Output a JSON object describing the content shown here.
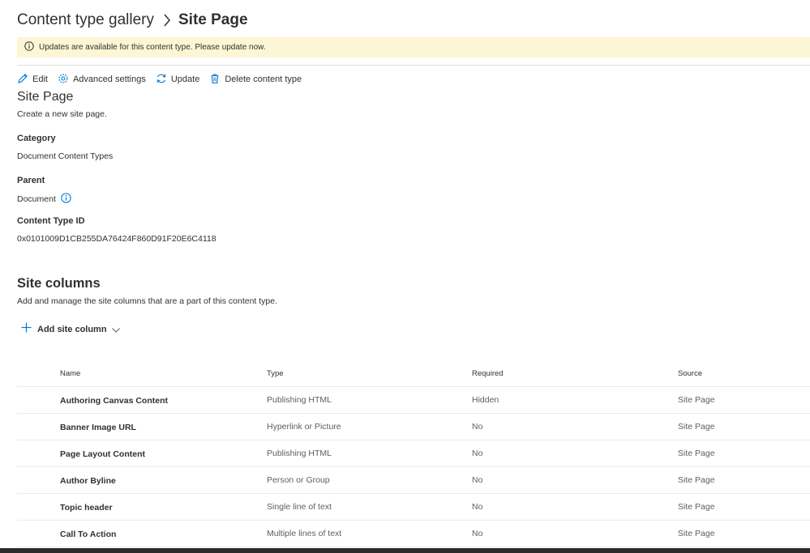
{
  "breadcrumb": {
    "root": "Content type gallery",
    "separator_icon": "chevron-right-icon",
    "current": "Site Page"
  },
  "banner": {
    "icon": "info-icon",
    "text": "Updates are available for this content type. Please update now.",
    "background": "#fdf6d5"
  },
  "commands": {
    "edit": "Edit",
    "advanced": "Advanced settings",
    "update": "Update",
    "delete": "Delete content type"
  },
  "details": {
    "title": "Site Page",
    "description": "Create a new site page.",
    "category_label": "Category",
    "category_value": "Document Content Types",
    "parent_label": "Parent",
    "parent_value": "Document",
    "id_label": "Content Type ID",
    "id_value": "0x0101009D1CB255DA76424F860D91F20E6C4118"
  },
  "site_columns": {
    "title": "Site columns",
    "description": "Add and manage the site columns that are a part of this content type.",
    "add_label": "Add site column",
    "headers": {
      "name": "Name",
      "type": "Type",
      "required": "Required",
      "source": "Source"
    },
    "rows": [
      {
        "name": "Authoring Canvas Content",
        "type": "Publishing HTML",
        "required": "Hidden",
        "source": "Site Page"
      },
      {
        "name": "Banner Image URL",
        "type": "Hyperlink or Picture",
        "required": "No",
        "source": "Site Page"
      },
      {
        "name": "Page Layout Content",
        "type": "Publishing HTML",
        "required": "No",
        "source": "Site Page"
      },
      {
        "name": "Author Byline",
        "type": "Person or Group",
        "required": "No",
        "source": "Site Page"
      },
      {
        "name": "Topic header",
        "type": "Single line of text",
        "required": "No",
        "source": "Site Page"
      },
      {
        "name": "Call To Action",
        "type": "Multiple lines of text",
        "required": "No",
        "source": "Site Page"
      }
    ]
  },
  "colors": {
    "accent": "#0078d4",
    "text": "#323130",
    "secondary_text": "#605e5c",
    "divider": "#edebe9"
  }
}
